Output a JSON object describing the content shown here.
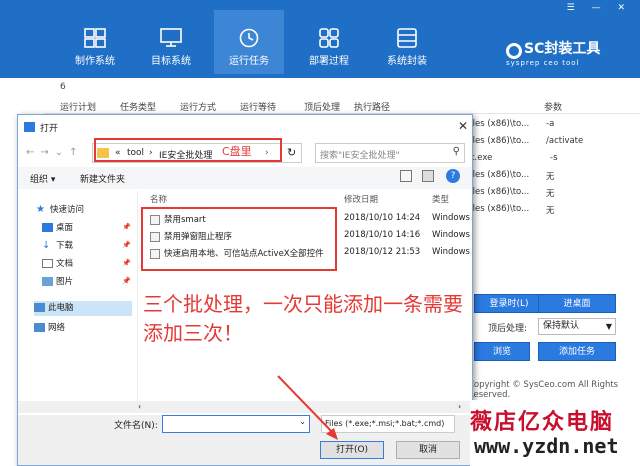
{
  "window": {
    "controls": "☰ — ✕"
  },
  "nav": {
    "items": [
      {
        "label": "制作系统"
      },
      {
        "label": "目标系统"
      },
      {
        "label": "运行任务"
      },
      {
        "label": "部署过程"
      },
      {
        "label": "系统封装"
      }
    ],
    "active_index": 2
  },
  "logo": {
    "title": "SC封装工具",
    "subtitle": "sysprep ceo tool"
  },
  "task_table": {
    "count_label": "6",
    "headers": [
      "运行计划",
      "任务类型",
      "运行方式",
      "运行等待",
      "顶后处理",
      "执行路径",
      "参数"
    ],
    "rows": [
      {
        "path": "Files (x86)\\to...",
        "param": "-a"
      },
      {
        "path": "Files (x86)\\to...",
        "param": "/activate"
      },
      {
        "path": "et.exe",
        "param": "-s"
      },
      {
        "path": "Files (x86)\\to...",
        "param": "无"
      },
      {
        "path": "Files (x86)\\to...",
        "param": "无"
      },
      {
        "path": "Files (x86)\\to...",
        "param": "无"
      }
    ]
  },
  "task_form": {
    "login_button": "登录时(L)",
    "enter_desktop_button": "进桌面",
    "post_label": "顶后处理:",
    "post_value": "保持默认",
    "browse_button": "浏览",
    "add_button": "添加任务",
    "copyright": "Copyright © SysCeo.com All Rights Reserved."
  },
  "dialog": {
    "title": "打开",
    "path": [
      "«",
      "tool",
      "›",
      "IE安全批处理",
      "›"
    ],
    "search_placeholder": "搜索\"IE安全批处理\"",
    "organize": "组织 ▾",
    "new_folder": "新建文件夹",
    "sidebar": [
      {
        "label": "快速访问",
        "icon": "star-icon"
      },
      {
        "label": "桌面",
        "icon": "desktop-icon"
      },
      {
        "label": "下载",
        "icon": "download-icon"
      },
      {
        "label": "文档",
        "icon": "document-icon"
      },
      {
        "label": "图片",
        "icon": "picture-icon"
      },
      {
        "label": "此电脑",
        "icon": "computer-icon"
      },
      {
        "label": "网络",
        "icon": "network-icon"
      }
    ],
    "columns": {
      "name": "名称",
      "date": "修改日期",
      "type": "类型"
    },
    "files": [
      {
        "name": "禁用smart",
        "date": "2018/10/10 14:24",
        "type": "Windows"
      },
      {
        "name": "禁用弹窗阻止程序",
        "date": "2018/10/10 14:16",
        "type": "Windows"
      },
      {
        "name": "快速启用本地、可信站点ActiveX全部控件",
        "date": "2018/10/12 21:53",
        "type": "Windows"
      }
    ],
    "filename_label": "文件名(N):",
    "filename_value": "",
    "filetype_value": "Files (*.exe;*.msi;*.bat;*.cmd)",
    "open_button": "打开(O)",
    "cancel_button": "取消"
  },
  "annotations": {
    "path_note": "C盘里",
    "main_note": "三个批处理，一次只能添加一条需要添加三次！"
  },
  "watermark": {
    "line1": "薇店亿众电脑",
    "line2": "www.yzdn.net"
  },
  "colors": {
    "brand_blue": "#1f6fc7",
    "annotation_red": "#e53935"
  }
}
